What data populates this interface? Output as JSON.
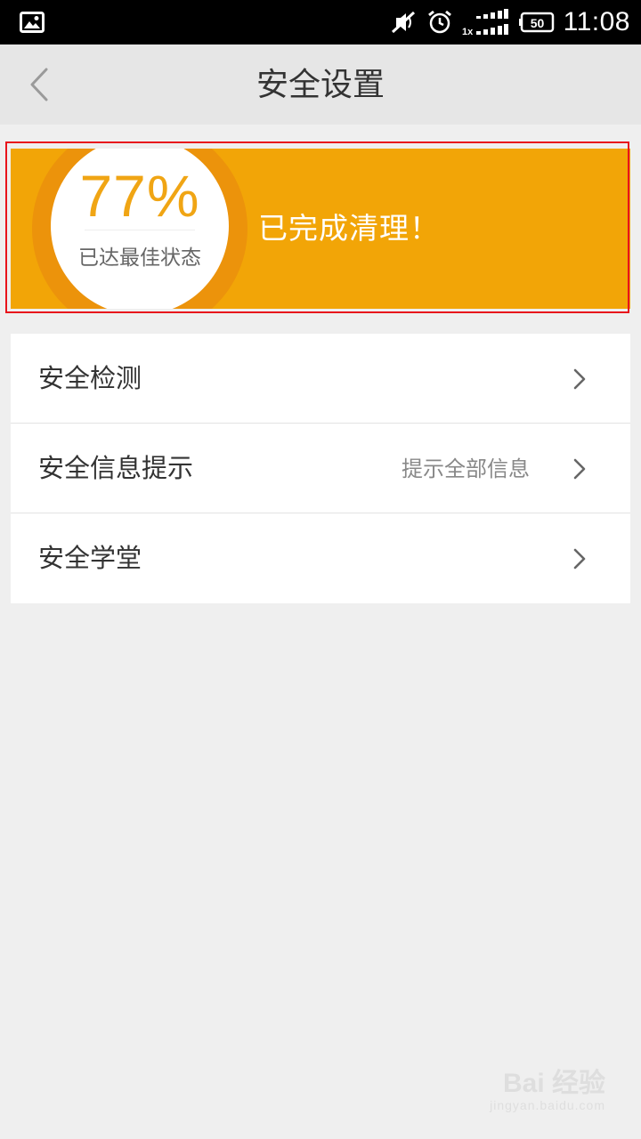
{
  "status_bar": {
    "left_icon": "image-notification-icon",
    "icons": [
      "mute-icon",
      "alarm-clock-icon",
      "signal-icon",
      "battery-icon"
    ],
    "network_label": "1x",
    "battery_level": "50",
    "time": "11:08"
  },
  "header": {
    "back_icon": "chevron-left-icon",
    "title": "安全设置"
  },
  "banner": {
    "score": "77%",
    "score_status": "已达最佳状态",
    "message": "已完成清理！",
    "colors": {
      "background": "#f2a507",
      "ring": "#ec930b",
      "score_text": "#f0a514",
      "highlight_frame": "#e8141c"
    }
  },
  "menu": {
    "items": [
      {
        "label": "安全检测",
        "value": "",
        "icon": "chevron-right-icon"
      },
      {
        "label": "安全信息提示",
        "value": "提示全部信息",
        "icon": "chevron-right-icon"
      },
      {
        "label": "安全学堂",
        "value": "",
        "icon": "chevron-right-icon"
      }
    ]
  },
  "watermark": {
    "brand": "Bai  经验",
    "url": "jingyan.baidu.com"
  }
}
